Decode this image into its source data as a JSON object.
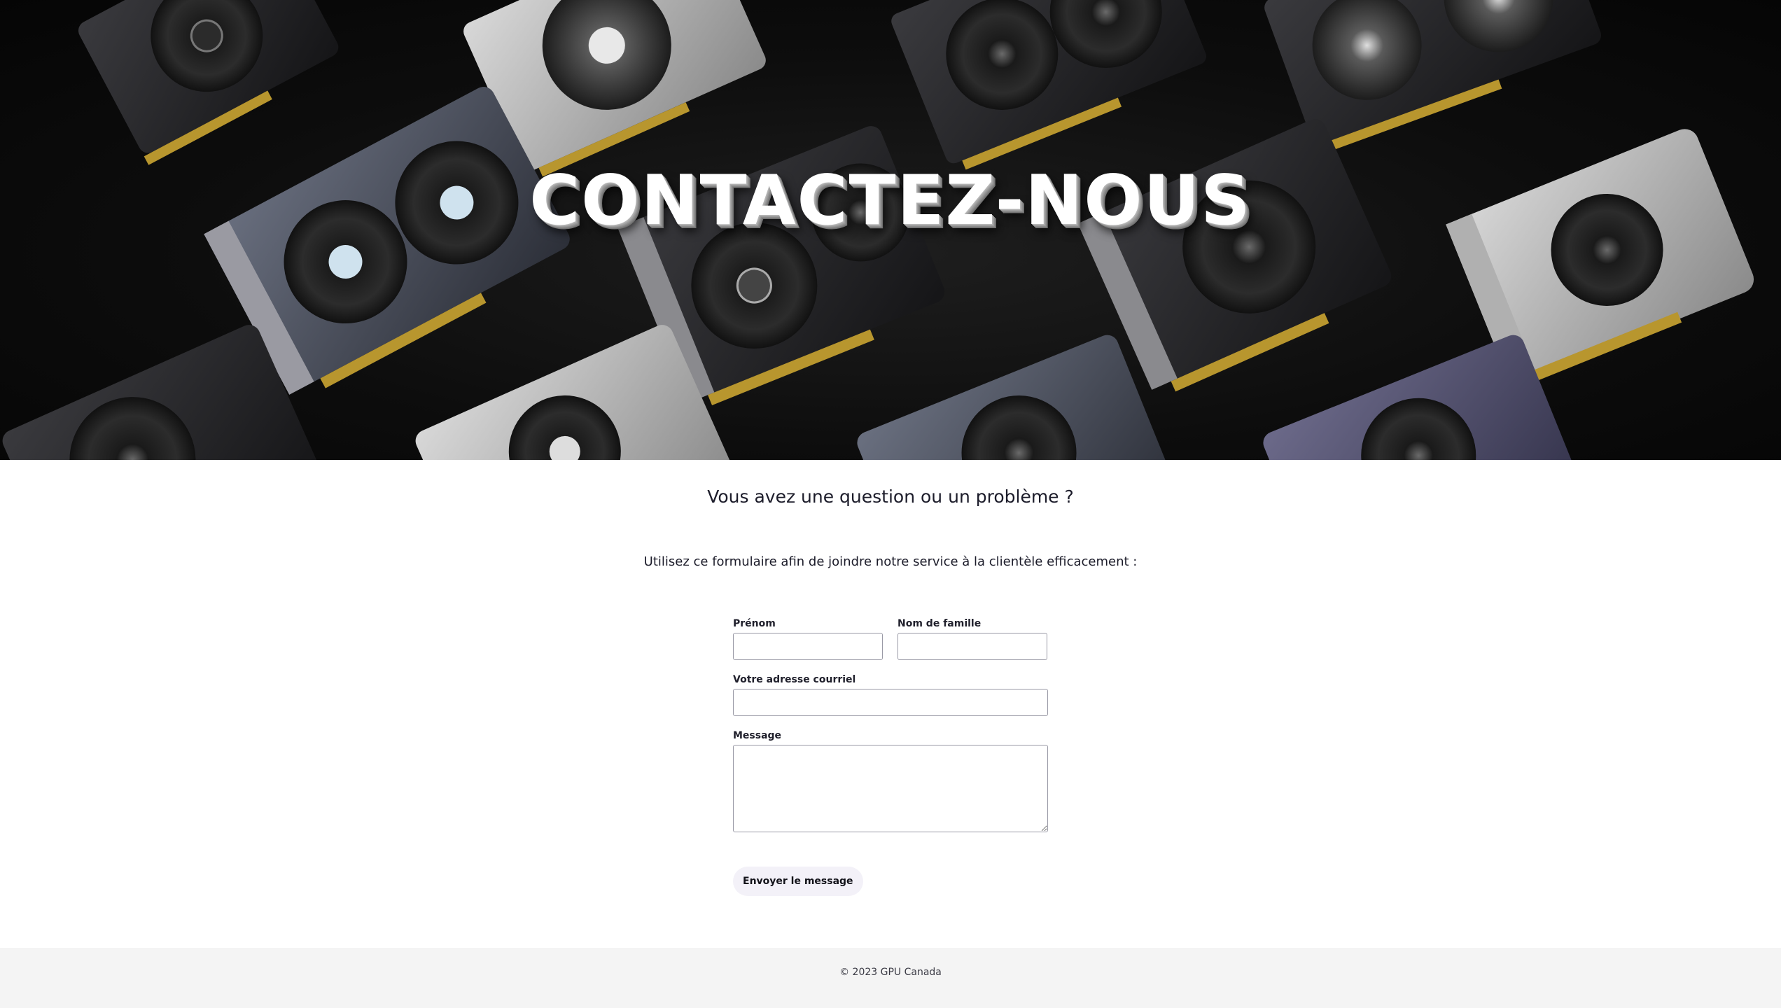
{
  "hero": {
    "title": "CONTACTEZ-NOUS"
  },
  "main": {
    "question": "Vous avez une question ou un problème ?",
    "intro": "Utilisez ce formulaire afin de joindre notre service à la clientèle efficacement :"
  },
  "form": {
    "first_name": {
      "label": "Prénom",
      "value": "",
      "placeholder": ""
    },
    "last_name": {
      "label": "Nom de famille",
      "value": "",
      "placeholder": ""
    },
    "email": {
      "label": "Votre adresse courriel",
      "value": "",
      "placeholder": ""
    },
    "message": {
      "label": "Message",
      "value": "",
      "placeholder": ""
    },
    "submit_label": "Envoyer le message"
  },
  "footer": {
    "copyright": "© 2023 GPU Canada"
  },
  "colors": {
    "hero_background": "#0d0d0d",
    "footer_background": "#f4f4f4",
    "submit_background": "#f3f1f8",
    "input_border": "#9a9aa6"
  }
}
